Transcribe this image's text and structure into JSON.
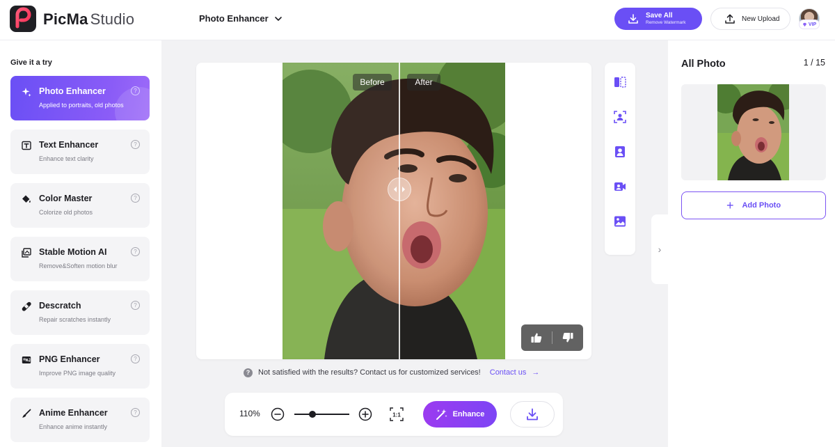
{
  "header": {
    "brand_name": "PicMa",
    "brand_suffix": "Studio",
    "tool_select": "Photo Enhancer",
    "save_all": "Save All",
    "save_all_sub": "Remove Watermark",
    "new_upload": "New Upload",
    "vip_badge": "VIP"
  },
  "sidebar": {
    "title": "Give it a try",
    "items": [
      {
        "name": "Photo Enhancer",
        "desc": "Applied to portraits, old photos",
        "icon": "sparkle-icon",
        "help": "?"
      },
      {
        "name": "Text Enhancer",
        "desc": "Enhance text clarity",
        "icon": "text-box-icon",
        "help": "?"
      },
      {
        "name": "Color Master",
        "desc": "Colorize old photos",
        "icon": "paint-bucket-icon",
        "help": "?"
      },
      {
        "name": "Stable Motion AI",
        "desc": "Remove&Soften motion blur",
        "icon": "motion-frame-icon",
        "help": "?"
      },
      {
        "name": "Descratch",
        "desc": "Repair scratches instantly",
        "icon": "bandage-icon",
        "help": "?"
      },
      {
        "name": "PNG Enhancer",
        "desc": "Improve PNG image quality",
        "icon": "png-file-icon",
        "help": "?"
      },
      {
        "name": "Anime Enhancer",
        "desc": "Enhance anime instantly",
        "icon": "brush-icon",
        "help": "?"
      }
    ]
  },
  "canvas": {
    "before_label": "Before",
    "after_label": "After"
  },
  "notice": {
    "help": "?",
    "text": "Not satisfied with the results? Contact us for customized services!",
    "link": "Contact us",
    "arrow": "→"
  },
  "bottombar": {
    "zoom": "110%",
    "zoom_level": 0.33,
    "ratio": "1:1",
    "enhance": "Enhance"
  },
  "right_panel": {
    "title": "All Photo",
    "count": "1 / 15",
    "add_photo": "Add Photo",
    "add_plus": "+"
  },
  "collapse_glyph": "›",
  "colors": {
    "accent": "#6a4ff5",
    "enhance_gradient_start": "#9b3bf0",
    "enhance_gradient_end": "#7d45f5"
  }
}
